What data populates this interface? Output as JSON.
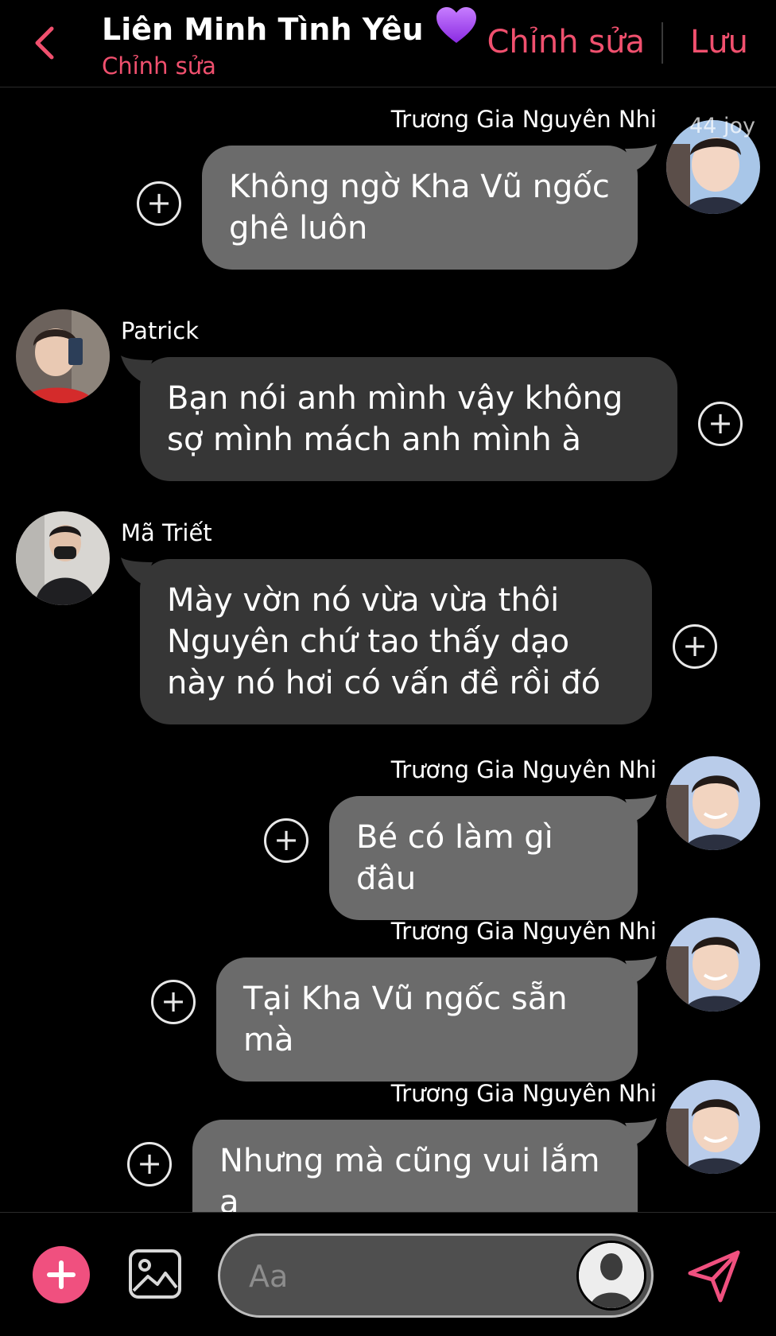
{
  "header": {
    "title": "Liên Minh Tình Yêu",
    "subtitle": "Chỉnh sửa",
    "edit_label": "Chỉnh sửa",
    "save_label": "Lưu"
  },
  "watermark": "44 joy",
  "messages": [
    {
      "side": "right",
      "sender": "Trương Gia Nguyên Nhi",
      "text": "Không ngờ Kha Vũ ngốc ghê luôn"
    },
    {
      "side": "left",
      "sender": "Patrick",
      "text": "Bạn nói anh mình vậy không sợ mình mách anh mình à"
    },
    {
      "side": "left",
      "sender": "Mã Triết",
      "text": "Mày vờn nó vừa vừa thôi Nguyên chứ tao thấy dạo này nó hơi có vấn đề rồi đó"
    },
    {
      "side": "right",
      "sender": "Trương Gia Nguyên Nhi",
      "text": "Bé có làm gì đâu"
    },
    {
      "side": "right",
      "sender": "Trương Gia Nguyên Nhi",
      "text": "Tại Kha Vũ ngốc sẵn mà"
    },
    {
      "side": "right",
      "sender": "Trương Gia Nguyên Nhi",
      "text": "Nhưng mà cũng vui lắm ạ"
    }
  ],
  "composer": {
    "placeholder": "Aa"
  },
  "colors": {
    "accent": "#f0506e",
    "plus_button": "#f0507f",
    "bubble_light": "#6b6b6b",
    "bubble_dark": "#363636",
    "background": "#000000"
  },
  "icons": {
    "back": "chevron-left-icon",
    "heart": "purple-heart-icon",
    "add": "plus-circle-icon",
    "image": "image-icon",
    "send": "send-icon",
    "person": "person-silhouette-icon"
  }
}
